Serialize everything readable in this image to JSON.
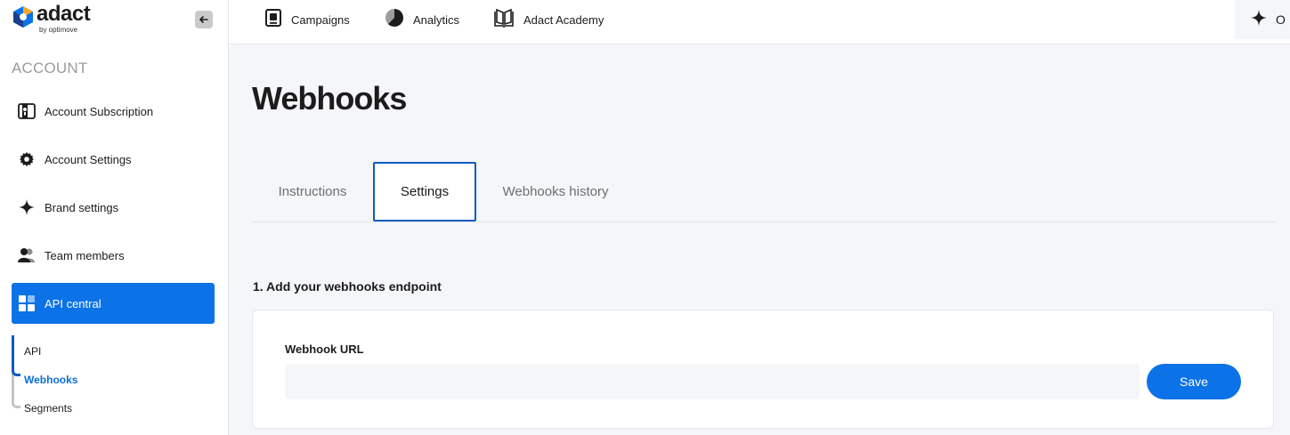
{
  "logo": {
    "word": "adact",
    "sub": "by optimove"
  },
  "sidebar": {
    "section_title": "ACCOUNT",
    "items": [
      {
        "label": "Account Subscription",
        "icon": "subscription-icon"
      },
      {
        "label": "Account Settings",
        "icon": "gear-icon"
      },
      {
        "label": "Brand settings",
        "icon": "sparkle-icon"
      },
      {
        "label": "Team members",
        "icon": "people-icon"
      },
      {
        "label": "API central",
        "icon": "grid-icon",
        "active": true
      }
    ],
    "sub_items": [
      {
        "label": "API"
      },
      {
        "label": "Webhooks",
        "active": true
      },
      {
        "label": "Segments"
      }
    ]
  },
  "topbar": {
    "links": [
      {
        "label": "Campaigns",
        "icon": "campaign-icon"
      },
      {
        "label": "Analytics",
        "icon": "pie-chart-icon"
      },
      {
        "label": "Adact Academy",
        "icon": "book-icon"
      }
    ],
    "right_label": "O"
  },
  "main": {
    "title": "Webhooks",
    "tabs": [
      {
        "label": "Instructions"
      },
      {
        "label": "Settings",
        "active": true
      },
      {
        "label": "Webhooks history"
      }
    ],
    "step_title": "1. Add your webhooks endpoint",
    "field_label": "Webhook URL",
    "url_value": "",
    "save_label": "Save"
  },
  "colors": {
    "accent": "#0b72e7",
    "background": "#f5f6f9"
  }
}
